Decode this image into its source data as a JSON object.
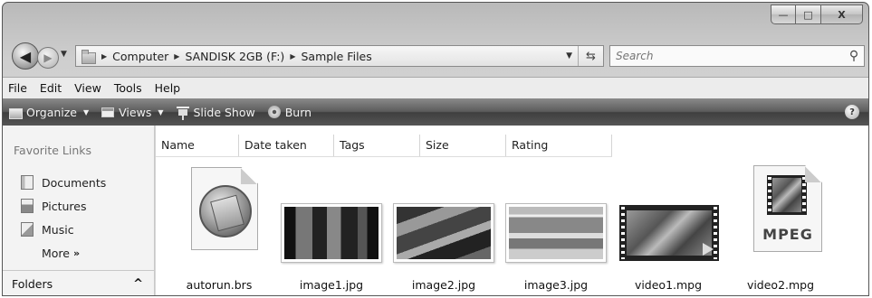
{
  "window": {
    "min_glyph": "—",
    "max_glyph": "□",
    "close_glyph": "X"
  },
  "address": {
    "crumbs": [
      "Computer",
      "SANDISK 2GB (F:)",
      "Sample Files"
    ]
  },
  "search": {
    "placeholder": "Search"
  },
  "menu": [
    "File",
    "Edit",
    "View",
    "Tools",
    "Help"
  ],
  "commands": {
    "organize": "Organize",
    "views": "Views",
    "slideshow": "Slide Show",
    "burn": "Burn",
    "help": "?"
  },
  "nav": {
    "title": "Favorite Links",
    "links": [
      "Documents",
      "Pictures",
      "Music"
    ],
    "more": "More",
    "folders": "Folders"
  },
  "columns": [
    "Name",
    "Date taken",
    "Tags",
    "Size",
    "Rating"
  ],
  "files": [
    {
      "name": "autorun.brs",
      "icon": "notepad-document-icon"
    },
    {
      "name": "image1.jpg",
      "icon": "photo-thumbnail"
    },
    {
      "name": "image2.jpg",
      "icon": "photo-thumbnail"
    },
    {
      "name": "image3.jpg",
      "icon": "photo-thumbnail"
    },
    {
      "name": "video1.mpg",
      "icon": "video-thumbnail"
    },
    {
      "name": "video2.mpg",
      "icon": "mpeg-document-icon",
      "badge": "MPEG"
    }
  ]
}
